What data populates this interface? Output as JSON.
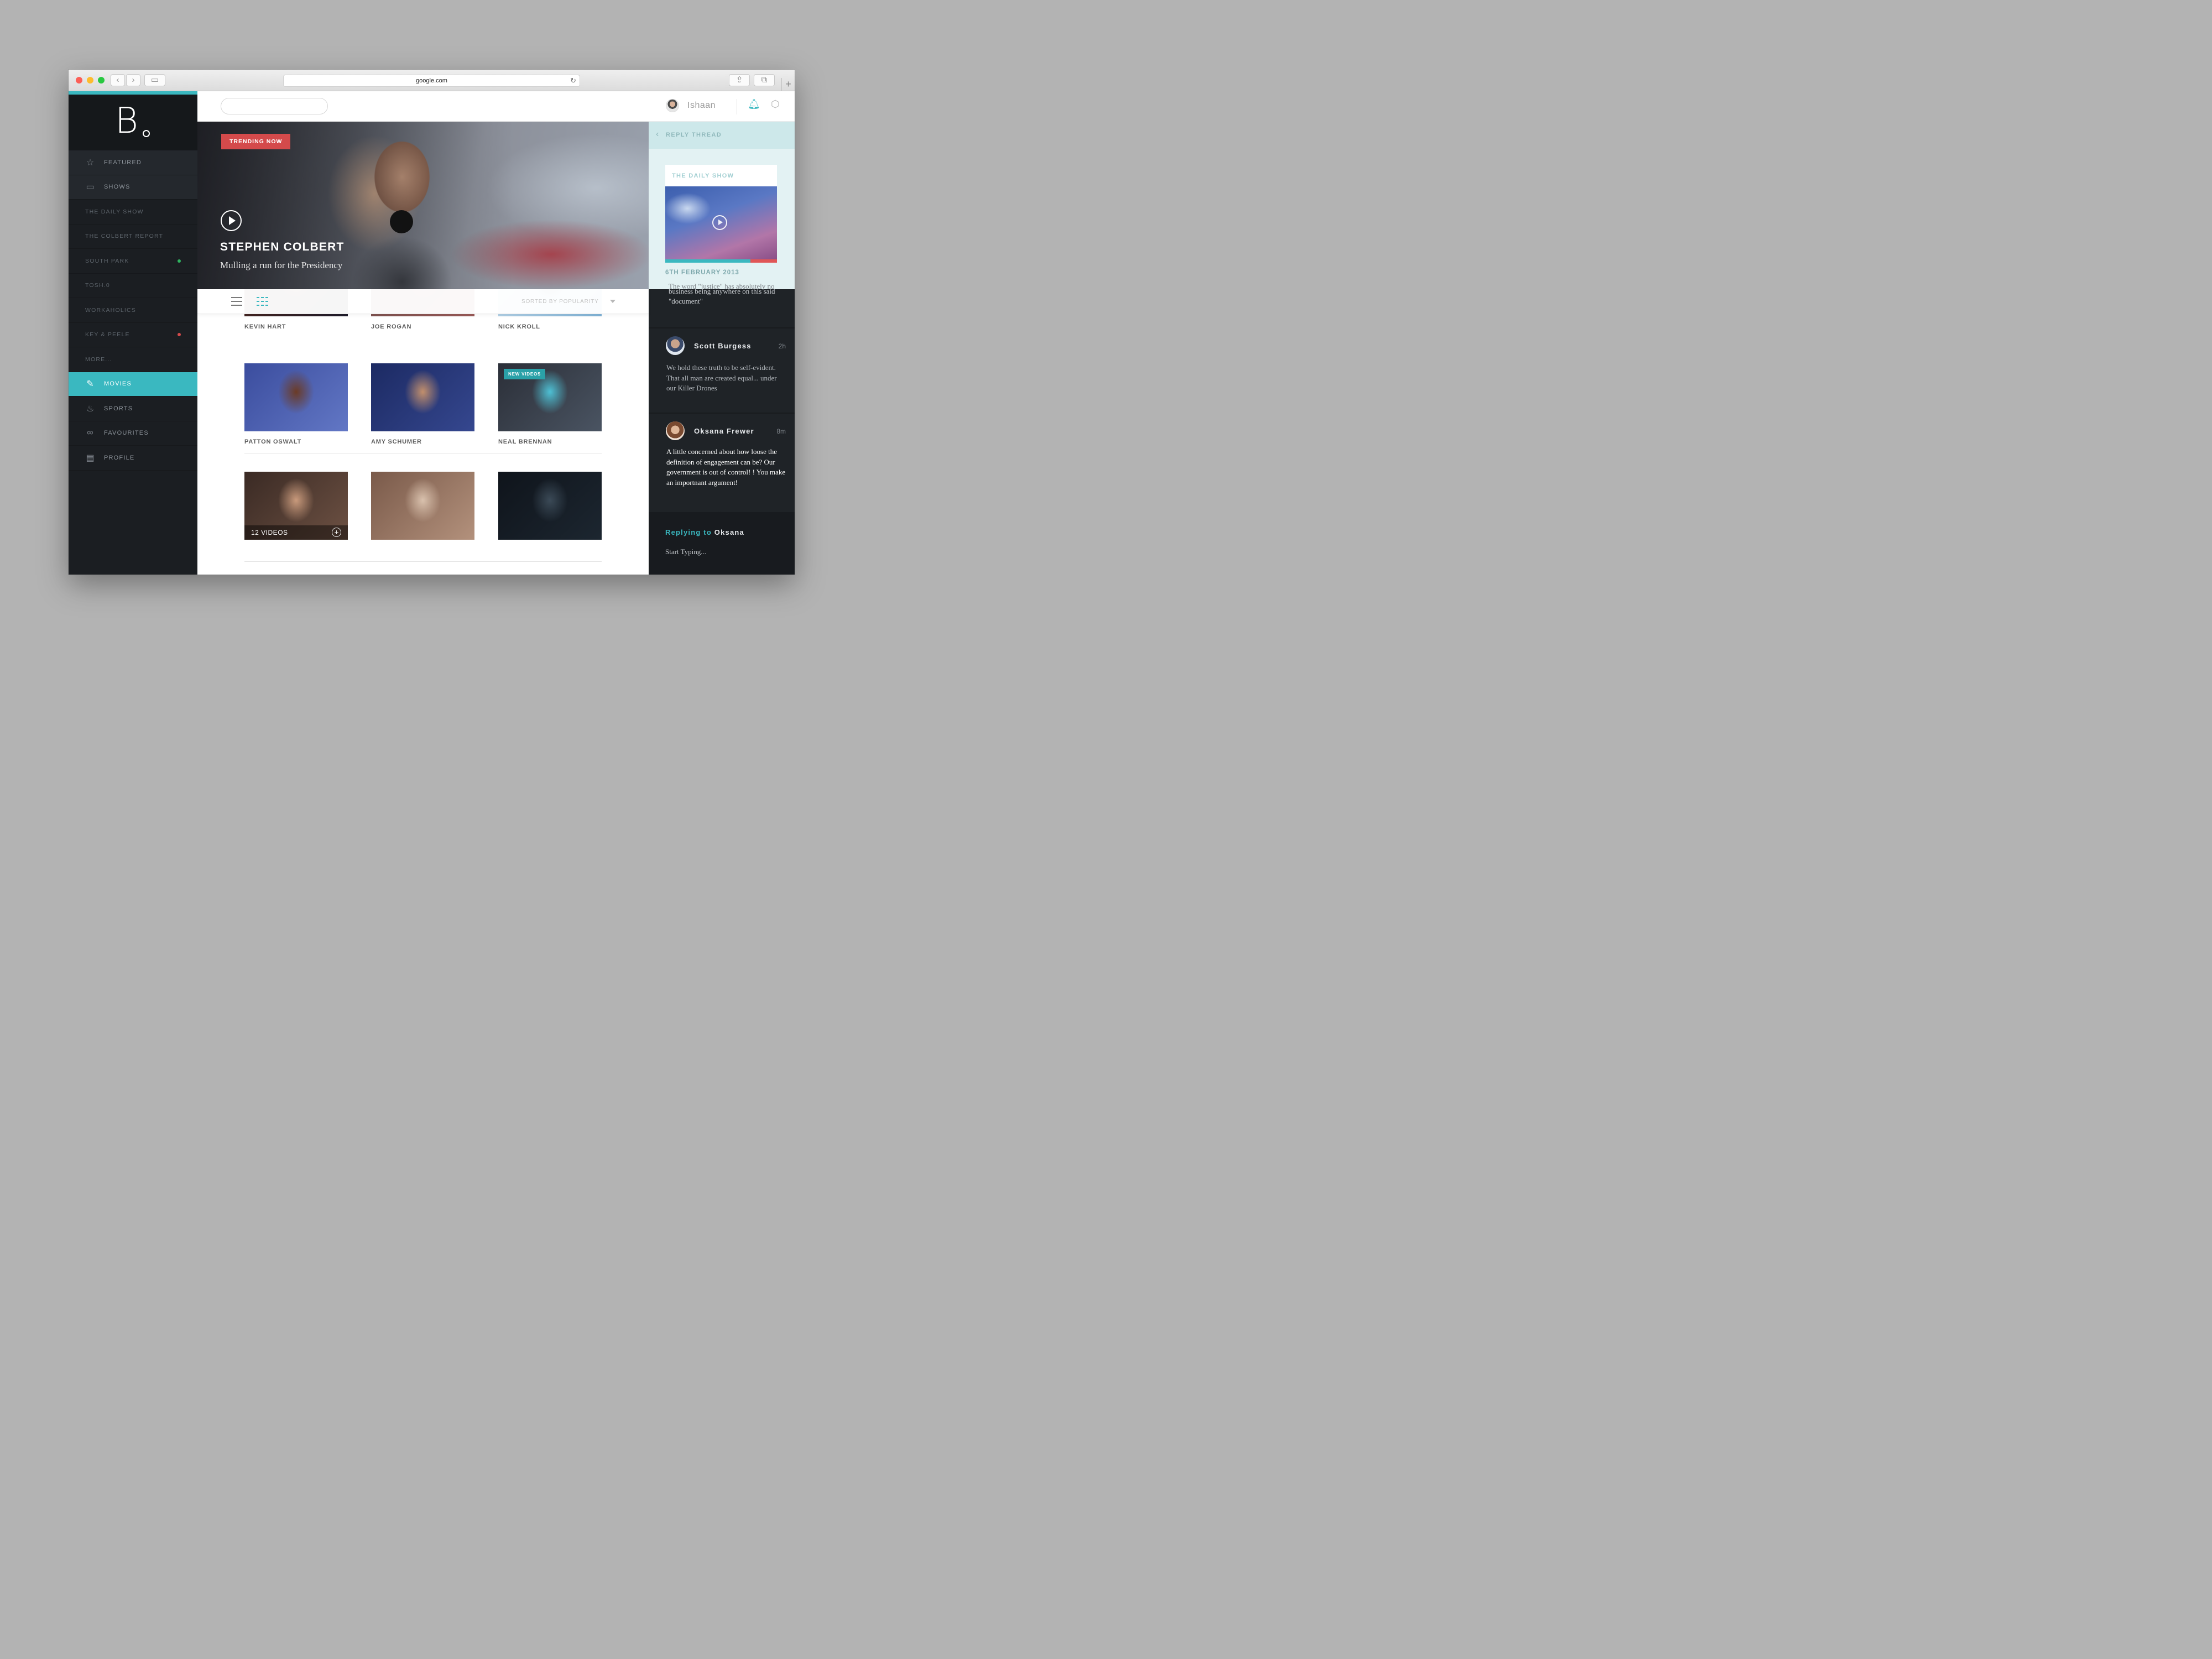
{
  "browser": {
    "url": "google.com"
  },
  "sidebar": {
    "main_items": [
      {
        "label": "Featured",
        "icon": "star-icon"
      },
      {
        "label": "Shows",
        "icon": "tv-icon"
      }
    ],
    "sub_items": [
      {
        "label": "The Daily Show",
        "dot": null
      },
      {
        "label": "The Colbert Report",
        "dot": null
      },
      {
        "label": "South Park",
        "dot": "#2fb35f"
      },
      {
        "label": "Tosh.0",
        "dot": null
      },
      {
        "label": "Workaholics",
        "dot": null
      },
      {
        "label": "Key & Peele",
        "dot": "#d44a4b"
      },
      {
        "label": "More...",
        "dot": null
      }
    ],
    "bottom_items": [
      {
        "label": "Movies",
        "icon": "microphone-icon",
        "active": true
      },
      {
        "label": "Sports",
        "icon": "flame-icon",
        "active": false
      },
      {
        "label": "Favourites",
        "icon": "glasses-icon",
        "active": false
      },
      {
        "label": "Profile",
        "icon": "id-card-icon",
        "active": false
      }
    ]
  },
  "header": {
    "search_placeholder": "",
    "username": "Ishaan"
  },
  "hero": {
    "badge": "TRENDING NOW",
    "title": "STEPHEN COLBERT",
    "subtitle": "Mulling a run for the Presidency"
  },
  "toolbar": {
    "sort_label": "SORTED BY POPULARITY"
  },
  "grid": {
    "rows": [
      [
        {
          "name": "KEVIN HART",
          "colors": [
            "#5b2a1c",
            "#1f1c2b",
            "#b04a1e"
          ]
        },
        {
          "name": "JOE ROGAN",
          "colors": [
            "#6d4d4a",
            "#9a5a58",
            "#c46373"
          ]
        },
        {
          "name": "NICK KROLL",
          "colors": [
            "#cfe2ef",
            "#7fb2d6",
            "#2a2c33"
          ]
        }
      ],
      [
        {
          "name": "PATTON OSWALT",
          "colors": [
            "#3b4d9e",
            "#6277c5",
            "#6b3b26"
          ]
        },
        {
          "name": "AMY SCHUMER",
          "colors": [
            "#1c2a63",
            "#35478f",
            "#c28f6c"
          ]
        },
        {
          "name": "NEAL BRENNAN",
          "colors": [
            "#2b2f38",
            "#4a5462",
            "#4ec0d4"
          ],
          "tag": "NEW VIDEOS"
        }
      ],
      [
        {
          "name": "",
          "colors": [
            "#3a2a24",
            "#6d5143",
            "#c99a7c"
          ],
          "overlay": "12 VIDEOS"
        },
        {
          "name": "",
          "colors": [
            "#7a5a4a",
            "#b3917c",
            "#d9c1ad"
          ]
        },
        {
          "name": "",
          "colors": [
            "#0f141b",
            "#1c2630",
            "#3b4a57"
          ]
        }
      ]
    ]
  },
  "reply_panel": {
    "header": "REPLY THREAD",
    "show_title": "THE DAILY SHOW",
    "show_date": "6TH FEBRUARY 2013",
    "progress": 0.76,
    "fragment_cut": "The word \"justice\" has absolutely no",
    "fragment": "business being anywhere on this said \"document\"",
    "comments": [
      {
        "author": "Scott Burgess",
        "time": "2h",
        "text": "We hold these truth to be self-evident. That all man are created equal... under our Killer Drones",
        "highlight": false
      },
      {
        "author": "Oksana Frewer",
        "time": "8m",
        "text": "A little concerned about how loose the definition of engagement can be? Our government is out of control! ! You make an importnant argument!",
        "highlight": true
      }
    ],
    "reply_lead": "Replying to",
    "reply_target": "Oksana",
    "reply_placeholder": "Start Typing..."
  },
  "colors": {
    "accent": "#3ab8c0",
    "sidebar_bg": "#1b1e22",
    "badge_red": "#d44a4b"
  }
}
